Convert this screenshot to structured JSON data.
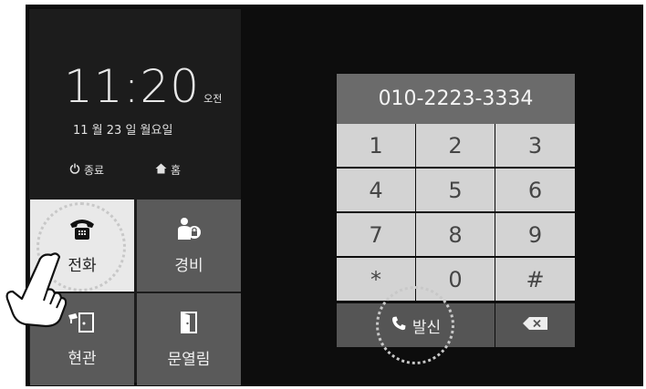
{
  "clock": {
    "time": "11:20",
    "ampm": "오전",
    "date": "11 월 23 일  월요일"
  },
  "quick": {
    "power_label": "종료",
    "home_label": "홈"
  },
  "tiles": [
    {
      "label": "전화",
      "icon": "telephone-icon"
    },
    {
      "label": "경비",
      "icon": "security-guard-icon"
    },
    {
      "label": "현관",
      "icon": "entrance-camera-icon"
    },
    {
      "label": "문열림",
      "icon": "door-open-icon"
    }
  ],
  "dialer": {
    "number": "010-2223-3334",
    "keys": [
      "1",
      "2",
      "3",
      "4",
      "5",
      "6",
      "7",
      "8",
      "9",
      "*",
      "0",
      "#"
    ],
    "call_label": "발신"
  },
  "colors": {
    "screen_bg": "#0d0d0d",
    "key_bg": "#d3d3d3",
    "display_bg": "#6b6b6b",
    "selected_tile": "#e9e9e9"
  }
}
